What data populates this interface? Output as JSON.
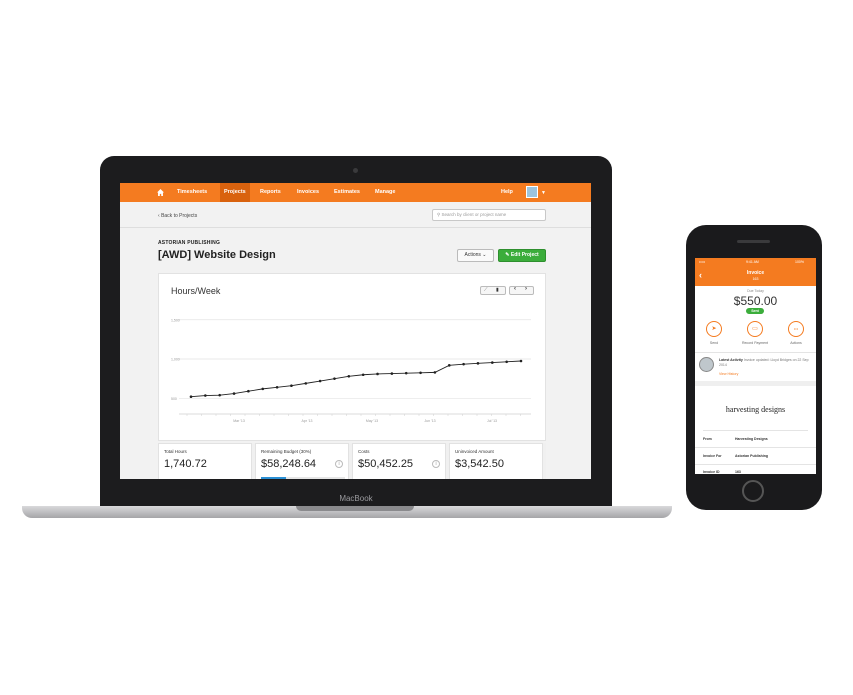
{
  "laptop": {
    "brand": "MacBook",
    "nav": {
      "items": [
        {
          "label": "Timesheets",
          "active": false
        },
        {
          "label": "Projects",
          "active": true
        },
        {
          "label": "Reports",
          "active": false
        },
        {
          "label": "Invoices",
          "active": false
        },
        {
          "label": "Estimates",
          "active": false
        },
        {
          "label": "Manage",
          "active": false
        }
      ],
      "help": "Help"
    },
    "back_link": "Back to Projects",
    "search_placeholder": "Search by client or project name",
    "client": "ASTORIAN PUBLISHING",
    "project_title": "[AWD] Website Design",
    "actions_label": "Actions",
    "edit_label": "Edit Project",
    "chart_title": "Hours/Week",
    "stats": [
      {
        "label": "Total Hours",
        "value": "1,740.72",
        "info": false
      },
      {
        "label": "Remaining Budget (30%)",
        "value": "$58,248.64",
        "info": true,
        "progress": 0.3
      },
      {
        "label": "Costs",
        "value": "$50,452.25",
        "info": true
      },
      {
        "label": "Uninvoiced Amount",
        "value": "$3,542.50",
        "info": false
      }
    ]
  },
  "chart_data": {
    "type": "line",
    "title": "Hours/Week",
    "xlabel": "",
    "ylabel": "",
    "yticks": [
      "1,500",
      "1,000",
      "500"
    ],
    "xticks": [
      "Mar '13",
      "Apr '13",
      "May '13",
      "Jun '13",
      "Jul '13"
    ],
    "ylim": [
      300,
      1650
    ],
    "x": [
      1,
      2,
      3,
      4,
      5,
      6,
      7,
      8,
      9,
      10,
      11,
      12,
      13,
      14,
      15,
      16,
      17,
      18,
      19,
      20,
      21,
      22,
      23,
      24
    ],
    "values": [
      520,
      535,
      540,
      560,
      590,
      620,
      640,
      660,
      690,
      720,
      750,
      780,
      800,
      810,
      815,
      820,
      825,
      830,
      920,
      935,
      945,
      955,
      965,
      975
    ]
  },
  "phone": {
    "status_time": "9:41 AM",
    "status_battery": "100%",
    "title": "Invoice",
    "subtitle": "163",
    "due_label": "Due Today",
    "amount": "$550.00",
    "badge": "Sent",
    "actions": [
      {
        "icon": "send-icon",
        "glyph": "➤",
        "label": "Send"
      },
      {
        "icon": "record-payment-icon",
        "glyph": "▭",
        "label": "Record Payment"
      },
      {
        "icon": "more-icon",
        "glyph": "•••",
        "label": "Actions"
      }
    ],
    "latest_title": "Latest Activity",
    "latest_text": "Invoice updated: Lloyd Bridges on 22 Sep 2014",
    "view_history": "View History",
    "company": "harvesting designs",
    "rows": [
      {
        "label": "From",
        "value": "Harvesting Designs"
      },
      {
        "label": "Invoice For",
        "value": "Astorian Publishing"
      },
      {
        "label": "Invoice ID",
        "value": "163"
      }
    ],
    "accent": "#f47b20"
  }
}
